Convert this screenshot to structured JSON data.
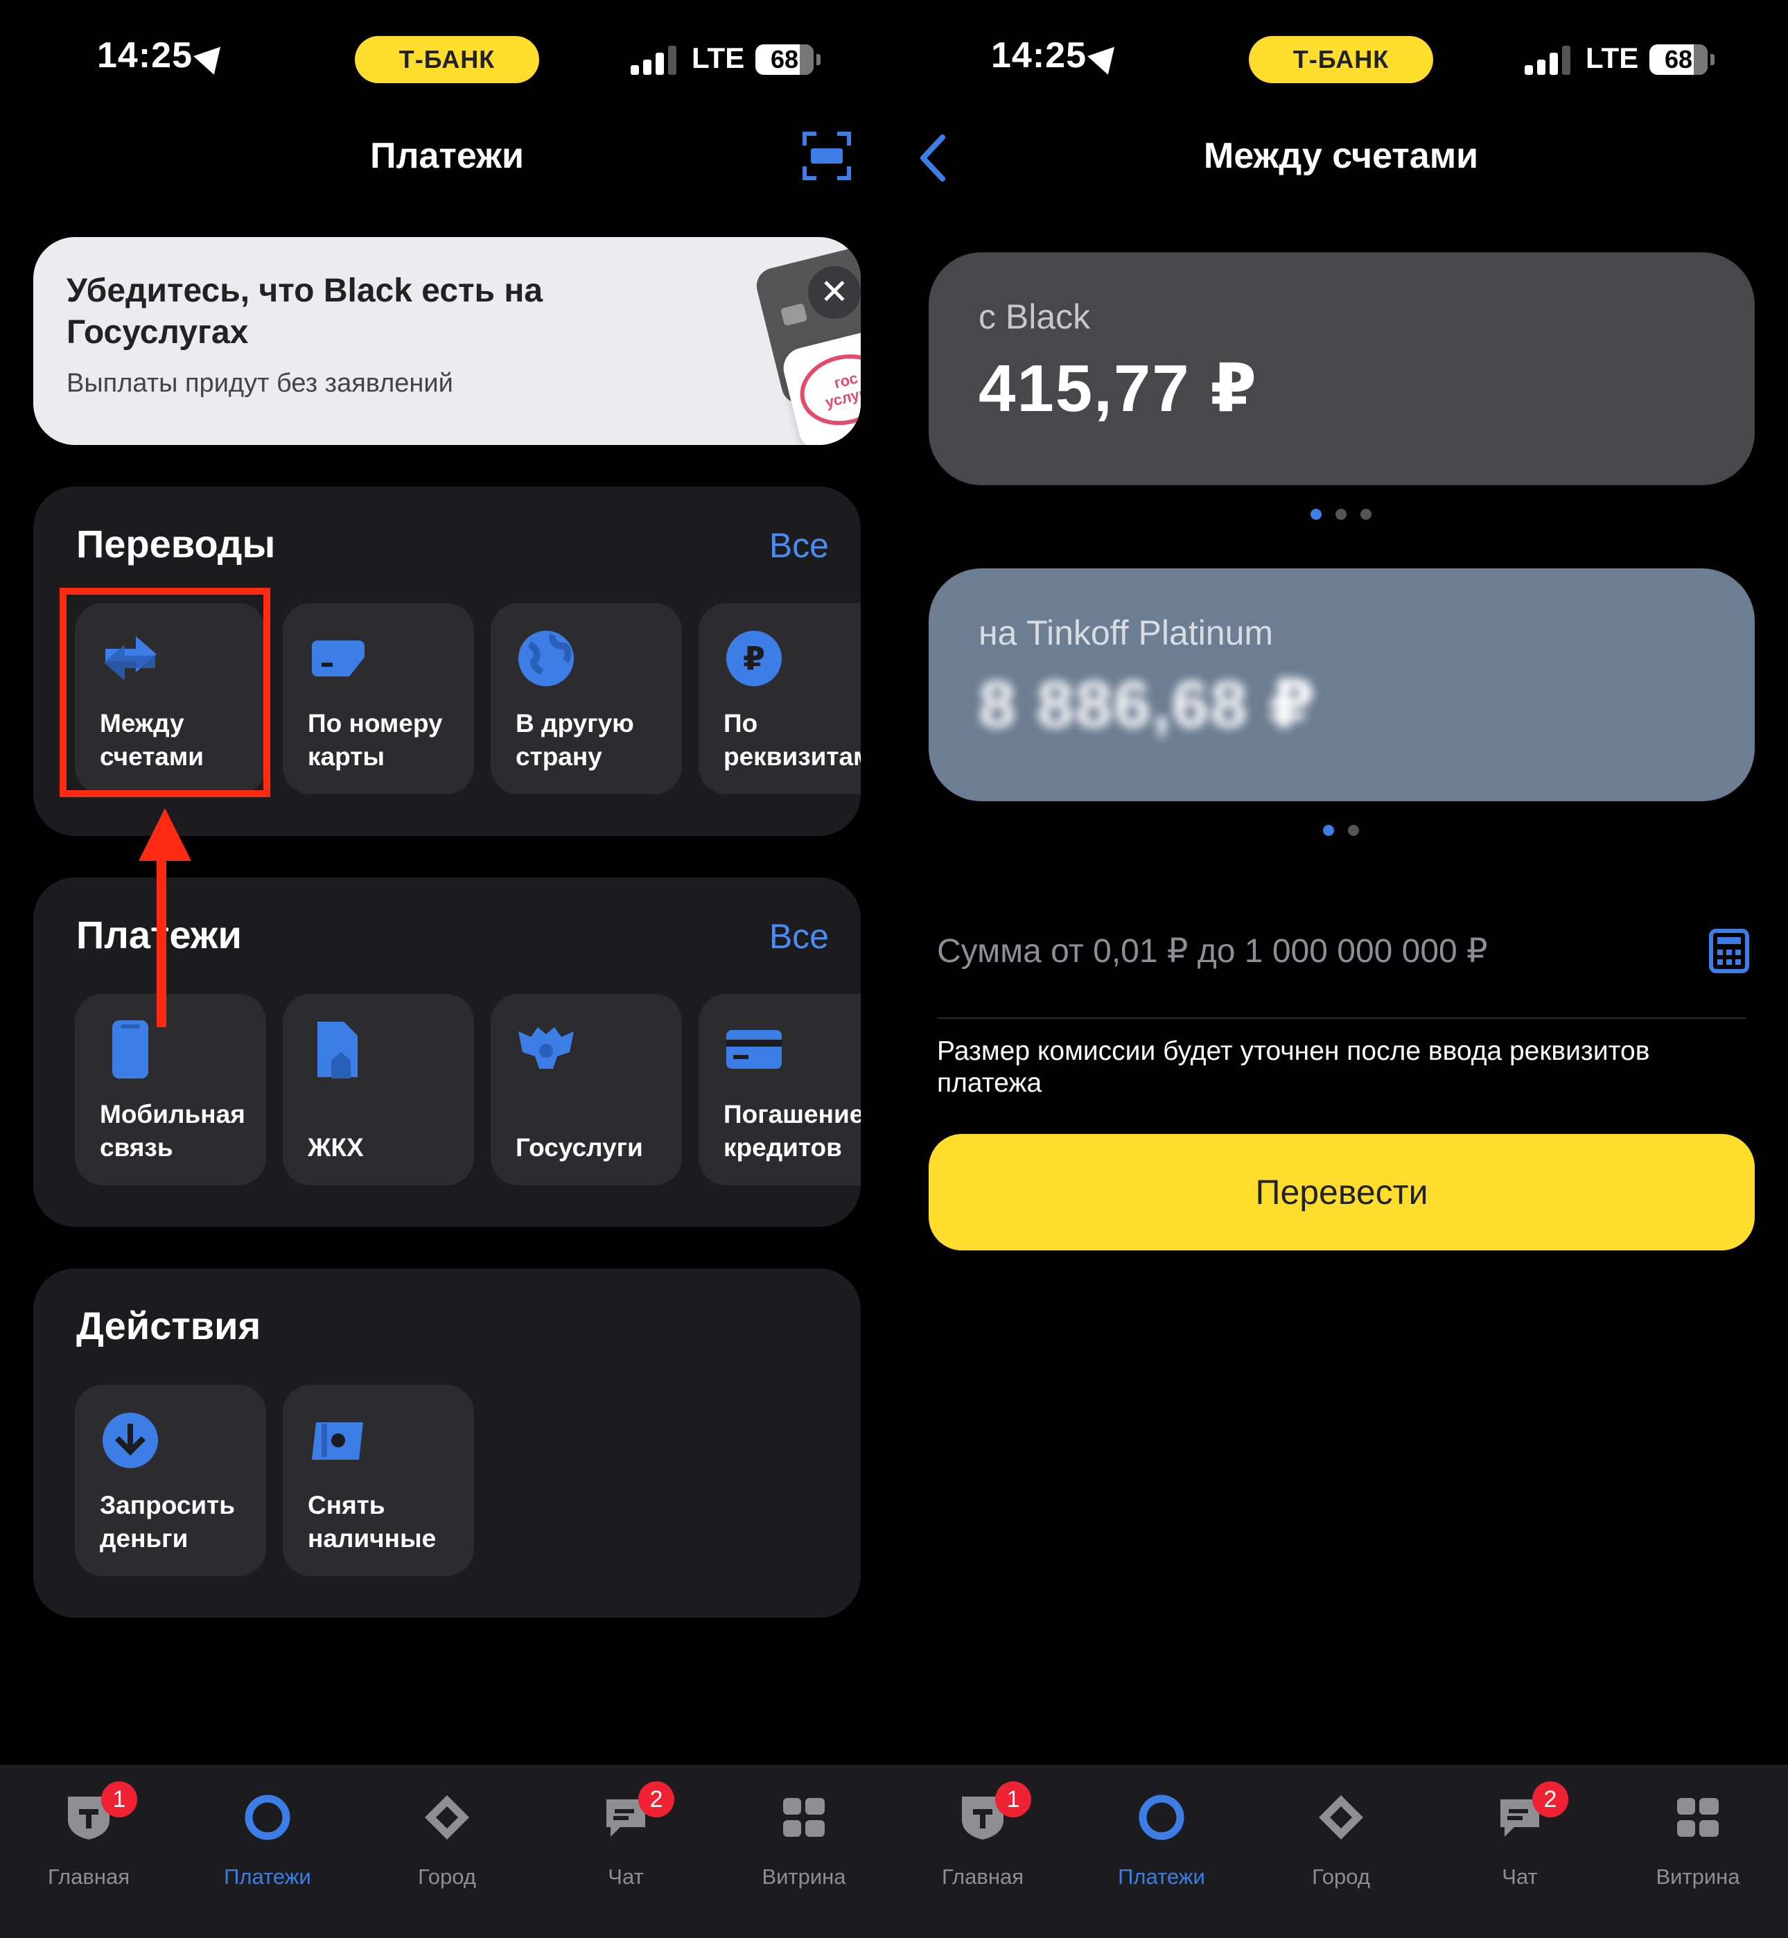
{
  "status": {
    "time": "14:25",
    "bank": "Т-БАНК",
    "network": "LTE",
    "battery": "68"
  },
  "left": {
    "title": "Платежи",
    "banner": {
      "title": "Убедитесь, что Black есть на Госуслугах",
      "subtitle": "Выплаты придут без заявлений",
      "close": "✕",
      "card_text": "гос услуги"
    },
    "transfers": {
      "title": "Переводы",
      "all": "Все",
      "items": [
        {
          "label": "Между\nсчетами",
          "icon": "arrows-exchange-icon"
        },
        {
          "label": "По номеру\nкарты",
          "icon": "card-icon"
        },
        {
          "label": "В другую\nстрану",
          "icon": "globe-icon"
        },
        {
          "label": "По\nреквизитам",
          "icon": "ruble-icon"
        }
      ]
    },
    "payments": {
      "title": "Платежи",
      "all": "Все",
      "items": [
        {
          "label": "Мобильная\nсвязь",
          "icon": "phone-icon"
        },
        {
          "label": "ЖКХ",
          "icon": "house-document-icon"
        },
        {
          "label": "Госуслуги",
          "icon": "coat-of-arms-icon"
        },
        {
          "label": "Погашение\nкредитов",
          "icon": "credit-card-icon"
        }
      ]
    },
    "actions": {
      "title": "Действия",
      "items": [
        {
          "label": "Запросить\nденьги",
          "icon": "download-arrow-icon"
        },
        {
          "label": "Снять\nналичные",
          "icon": "cash-icon"
        }
      ]
    }
  },
  "right": {
    "title": "Между счетами",
    "from": {
      "label": "с Black",
      "amount": "415,77 ₽"
    },
    "to": {
      "label": "на Tinkoff Platinum",
      "amount": "8 886,68 ₽"
    },
    "amount_placeholder": "Сумма от 0,01 ₽ до 1 000 000 000 ₽",
    "fee_note": "Размер комиссии будет уточнен после ввода реквизитов платежа",
    "submit": "Перевести"
  },
  "tabbar": {
    "items": [
      {
        "label": "Главная",
        "badge": "1",
        "icon": "t-shield-icon"
      },
      {
        "label": "Платежи",
        "badge": "",
        "icon": "circle-icon"
      },
      {
        "label": "Город",
        "badge": "",
        "icon": "diamond-icon"
      },
      {
        "label": "Чат",
        "badge": "2",
        "icon": "chat-icon"
      },
      {
        "label": "Витрина",
        "badge": "",
        "icon": "grid-icon"
      }
    ]
  },
  "colors": {
    "accent": "#3d7ee6",
    "yellow": "#ffdd2d",
    "annotation": "#ff2a12",
    "badge": "#ee2233"
  }
}
